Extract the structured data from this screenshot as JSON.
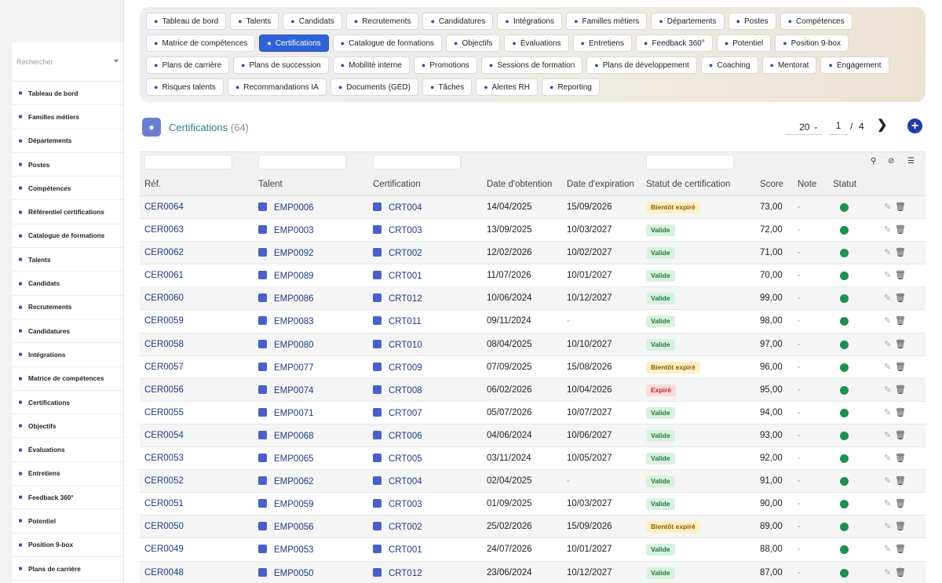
{
  "sidebar": {
    "search_placeholder": "Rechercher",
    "items": [
      {
        "label": "Tableau de bord",
        "icon": "dashboard-icon"
      },
      {
        "label": "Familles métiers",
        "icon": "sitemap-icon"
      },
      {
        "label": "Départements",
        "icon": "building-icon"
      },
      {
        "label": "Postes",
        "icon": "id-card-icon"
      },
      {
        "label": "Compétences",
        "icon": "brain-icon"
      },
      {
        "label": "Référentiel certifications",
        "icon": "certificate-icon"
      },
      {
        "label": "Catalogue de formations",
        "icon": "graduation-cap-icon"
      },
      {
        "label": "Talents",
        "icon": "user-icon"
      },
      {
        "label": "Candidats",
        "icon": "user-plus-icon"
      },
      {
        "label": "Recrutements",
        "icon": "megaphone-icon"
      },
      {
        "label": "Candidatures",
        "icon": "file-signature-icon"
      },
      {
        "label": "Intégrations",
        "icon": "building-user-icon"
      },
      {
        "label": "Matrice de compétences",
        "icon": "network-icon"
      },
      {
        "label": "Certifications",
        "icon": "award-icon"
      },
      {
        "label": "Objectifs",
        "icon": "target-icon"
      },
      {
        "label": "Évaluations",
        "icon": "star-icon"
      },
      {
        "label": "Entretiens",
        "icon": "comments-icon"
      },
      {
        "label": "Feedback 360°",
        "icon": "comment-dots-icon"
      },
      {
        "label": "Potentiel",
        "icon": "chart-line-icon"
      },
      {
        "label": "Position 9-box",
        "icon": "grid-icon"
      },
      {
        "label": "Plans de carrière",
        "icon": "signs-post-icon"
      }
    ]
  },
  "topnav": {
    "rows": [
      [
        {
          "label": "Tableau de bord",
          "icon": "dashboard-icon"
        },
        {
          "label": "Talents",
          "icon": "user-icon"
        },
        {
          "label": "Candidats",
          "icon": "user-plus-icon"
        },
        {
          "label": "Recrutements",
          "icon": "megaphone-icon"
        },
        {
          "label": "Candidatures",
          "icon": "file-signature-icon"
        },
        {
          "label": "Intégrations",
          "icon": "building-user-icon"
        },
        {
          "label": "Familles métiers",
          "icon": "sitemap-icon"
        },
        {
          "label": "Départements",
          "icon": "building-icon"
        },
        {
          "label": "Postes",
          "icon": "id-card-icon"
        },
        {
          "label": "Compétences",
          "icon": "brain-icon"
        }
      ],
      [
        {
          "label": "Matrice de compétences",
          "icon": "network-icon"
        },
        {
          "label": "Certifications",
          "icon": "award-icon",
          "active": true
        },
        {
          "label": "Catalogue de formations",
          "icon": "graduation-cap-icon"
        },
        {
          "label": "Objectifs",
          "icon": "target-icon"
        },
        {
          "label": "Évaluations",
          "icon": "star-icon"
        },
        {
          "label": "Entretiens",
          "icon": "comments-icon"
        },
        {
          "label": "Feedback 360°",
          "icon": "comment-dots-icon"
        },
        {
          "label": "Potentiel",
          "icon": "chart-line-icon"
        },
        {
          "label": "Position 9-box",
          "icon": "grid-icon"
        }
      ],
      [
        {
          "label": "Plans de carrière",
          "icon": "signs-post-icon"
        },
        {
          "label": "Plans de succession",
          "icon": "sitemap-icon"
        },
        {
          "label": "Mobilité interne",
          "icon": "arrows-icon"
        },
        {
          "label": "Promotions",
          "icon": "arrow-up-icon"
        },
        {
          "label": "Sessions de formation",
          "icon": "chalkboard-icon"
        },
        {
          "label": "Plans de développement",
          "icon": "clipboard-icon"
        },
        {
          "label": "Coaching",
          "icon": "handshake-icon"
        },
        {
          "label": "Mentorat",
          "icon": "teacher-icon"
        },
        {
          "label": "Engagement",
          "icon": "heart-icon"
        }
      ],
      [
        {
          "label": "Risques talents",
          "icon": "warning-icon"
        },
        {
          "label": "Recommandations IA",
          "icon": "robot-icon"
        },
        {
          "label": "Documents (GED)",
          "icon": "folder-icon"
        },
        {
          "label": "Tâches",
          "icon": "list-check-icon"
        },
        {
          "label": "Alertes RH",
          "icon": "bell-icon"
        },
        {
          "label": "Reporting",
          "icon": "pie-chart-icon"
        }
      ]
    ]
  },
  "header": {
    "title": "Certifications",
    "count": "(64)",
    "per_page": "20",
    "page_current": "1",
    "page_sep": "/",
    "page_total": "4"
  },
  "table": {
    "columns": [
      "Réf.",
      "Talent",
      "Certification",
      "Date d'obtention",
      "Date d'expiration",
      "Statut de certification",
      "Score",
      "Note",
      "Statut"
    ],
    "rows": [
      {
        "ref": "CER0064",
        "talent": "EMP0006",
        "cert": "CRT004",
        "obtained": "14/04/2025",
        "expires": "15/09/2026",
        "status": "Bientôt expiré",
        "kind": "bientot",
        "score": "73,00",
        "note": "-"
      },
      {
        "ref": "CER0063",
        "talent": "EMP0003",
        "cert": "CRT003",
        "obtained": "13/09/2025",
        "expires": "10/03/2027",
        "status": "Valide",
        "kind": "valide",
        "score": "72,00",
        "note": "-"
      },
      {
        "ref": "CER0062",
        "talent": "EMP0092",
        "cert": "CRT002",
        "obtained": "12/02/2026",
        "expires": "10/02/2027",
        "status": "Valide",
        "kind": "valide",
        "score": "71,00",
        "note": "-"
      },
      {
        "ref": "CER0061",
        "talent": "EMP0089",
        "cert": "CRT001",
        "obtained": "11/07/2026",
        "expires": "10/01/2027",
        "status": "Valide",
        "kind": "valide",
        "score": "70,00",
        "note": "-"
      },
      {
        "ref": "CER0060",
        "talent": "EMP0086",
        "cert": "CRT012",
        "obtained": "10/06/2024",
        "expires": "10/12/2027",
        "status": "Valide",
        "kind": "valide",
        "score": "99,00",
        "note": "-"
      },
      {
        "ref": "CER0059",
        "talent": "EMP0083",
        "cert": "CRT011",
        "obtained": "09/11/2024",
        "expires": "-",
        "status": "Valide",
        "kind": "valide",
        "score": "98,00",
        "note": "-"
      },
      {
        "ref": "CER0058",
        "talent": "EMP0080",
        "cert": "CRT010",
        "obtained": "08/04/2025",
        "expires": "10/10/2027",
        "status": "Valide",
        "kind": "valide",
        "score": "97,00",
        "note": "-"
      },
      {
        "ref": "CER0057",
        "talent": "EMP0077",
        "cert": "CRT009",
        "obtained": "07/09/2025",
        "expires": "15/08/2026",
        "status": "Bientôt expiré",
        "kind": "bientot",
        "score": "96,00",
        "note": "-"
      },
      {
        "ref": "CER0056",
        "talent": "EMP0074",
        "cert": "CRT008",
        "obtained": "06/02/2026",
        "expires": "10/04/2026",
        "status": "Expiré",
        "kind": "expire",
        "score": "95,00",
        "note": "-"
      },
      {
        "ref": "CER0055",
        "talent": "EMP0071",
        "cert": "CRT007",
        "obtained": "05/07/2026",
        "expires": "10/07/2027",
        "status": "Valide",
        "kind": "valide",
        "score": "94,00",
        "note": "-"
      },
      {
        "ref": "CER0054",
        "talent": "EMP0068",
        "cert": "CRT006",
        "obtained": "04/06/2024",
        "expires": "10/06/2027",
        "status": "Valide",
        "kind": "valide",
        "score": "93,00",
        "note": "-"
      },
      {
        "ref": "CER0053",
        "talent": "EMP0065",
        "cert": "CRT005",
        "obtained": "03/11/2024",
        "expires": "10/05/2027",
        "status": "Valide",
        "kind": "valide",
        "score": "92,00",
        "note": "-"
      },
      {
        "ref": "CER0052",
        "talent": "EMP0062",
        "cert": "CRT004",
        "obtained": "02/04/2025",
        "expires": "-",
        "status": "Valide",
        "kind": "valide",
        "score": "91,00",
        "note": "-"
      },
      {
        "ref": "CER0051",
        "talent": "EMP0059",
        "cert": "CRT003",
        "obtained": "01/09/2025",
        "expires": "10/03/2027",
        "status": "Valide",
        "kind": "valide",
        "score": "90,00",
        "note": "-"
      },
      {
        "ref": "CER0050",
        "talent": "EMP0056",
        "cert": "CRT002",
        "obtained": "25/02/2026",
        "expires": "15/09/2026",
        "status": "Bientôt expiré",
        "kind": "bientot",
        "score": "89,00",
        "note": "-"
      },
      {
        "ref": "CER0049",
        "talent": "EMP0053",
        "cert": "CRT001",
        "obtained": "24/07/2026",
        "expires": "10/01/2027",
        "status": "Valide",
        "kind": "valide",
        "score": "88,00",
        "note": "-"
      },
      {
        "ref": "CER0048",
        "talent": "EMP0050",
        "cert": "CRT012",
        "obtained": "23/06/2024",
        "expires": "10/12/2027",
        "status": "Valide",
        "kind": "valide",
        "score": "87,00",
        "note": "-"
      }
    ]
  },
  "colors": {
    "accent": "#2f62d6",
    "title": "#2a7c96",
    "link": "#1d3a8a",
    "status_active": "#1e8f50"
  }
}
